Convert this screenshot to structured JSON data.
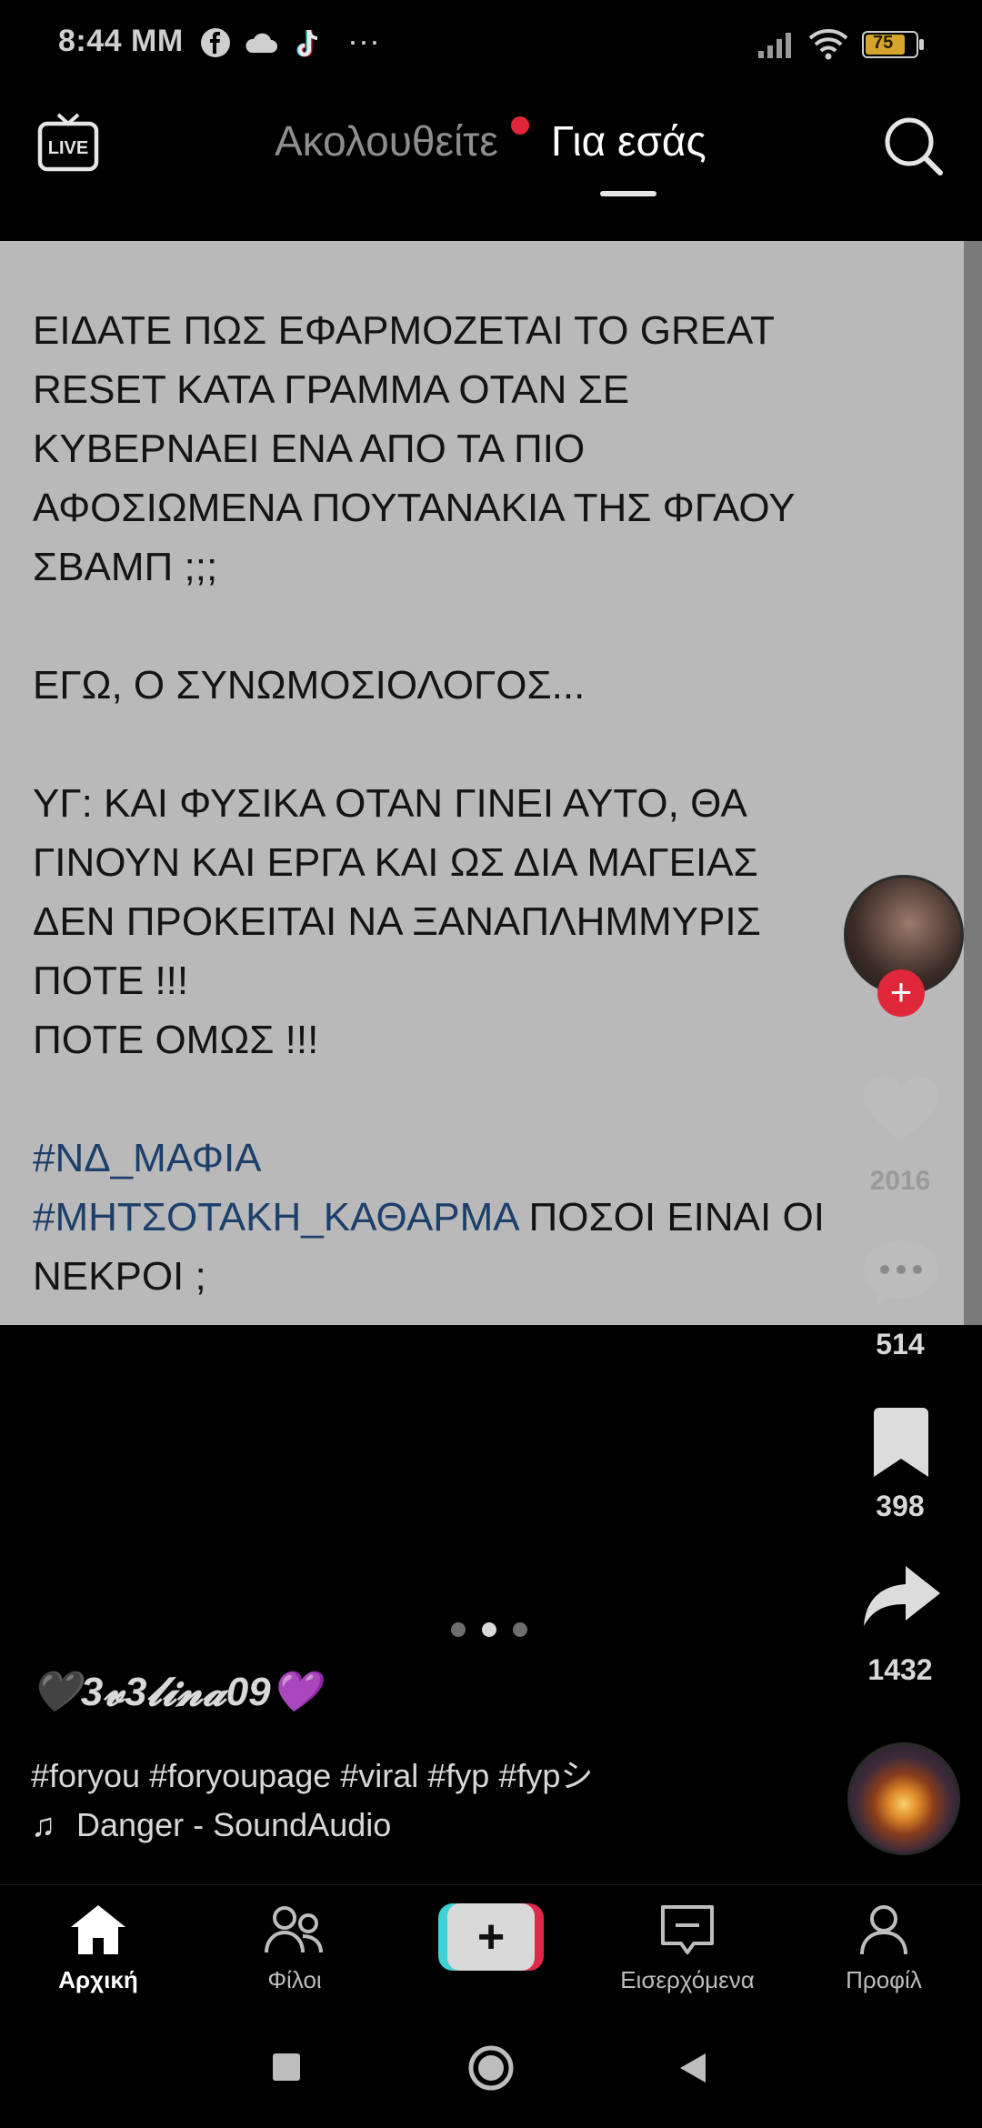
{
  "status_bar": {
    "time": "8:44 MM",
    "battery": "75",
    "icons": [
      "facebook-icon",
      "cloud-icon",
      "tiktok-icon",
      "more-icon",
      "signal-icon",
      "wifi-icon",
      "battery-icon"
    ]
  },
  "top_nav": {
    "live_label": "LIVE",
    "tab_following": "Ακολουθείτε",
    "tab_foryou": "Για εσάς",
    "notification_color": "#e0273a"
  },
  "post": {
    "lines": [
      "ΕΙΔΑΤΕ ΠΩΣ ΕΦΑΡΜΟΖΕΤΑΙ ΤΟ GREAT",
      "RESET ΚΑΤΑ ΓΡΑΜΜΑ ΟΤΑΝ ΣΕ",
      "ΚΥΒΕΡΝΑΕΙ ΕΝΑ ΑΠΟ ΤΑ ΠΙΟ",
      "ΑΦΟΣΙΩΜΕΝΑ ΠΟΥΤΑΝΑΚΙΑ ΤΗΣ ΦΓΑΟΥ",
      "ΣΒΑΜΠ ;;;",
      "ΕΓΩ, Ο ΣΥΝΩΜΟΣΙΟΛΟΓΟΣ...",
      "ΥΓ: ΚΑΙ ΦΥΣΙΚΑ ΟΤΑΝ ΓΙΝΕΙ ΑΥΤΟ, ΘΑ",
      "ΓΙΝΟΥΝ ΚΑΙ ΕΡΓΑ ΚΑΙ ΩΣ ΔΙΑ ΜΑΓΕΙΑΣ",
      "ΔΕΝ ΠΡΟΚΕΙΤΑΙ ΝΑ ΞΑΝΑΠΛΗΜΜΥΡΙΣ",
      "ΠΟΤΕ !!!",
      "ΠΟΤΕ ΟΜΩΣ !!!",
      "#ΝΔ_ΜΑΦΙΑ",
      "#ΜΗΤΣΟΤΑΚΗ_ΚΑΘΑΡΜΑ",
      " ΠΟΣΟΙ ΕΙΝΑΙ ΟΙ",
      "ΝΕΚΡΟΙ ;"
    ],
    "hashtag_color": "#1d3f6b"
  },
  "actions": {
    "likes": "2016",
    "comments": "514",
    "bookmarks": "398",
    "shares": "1432",
    "follow_symbol": "+"
  },
  "info": {
    "username": "🖤3𝓿3𝓵𝓲𝓷𝓪09💜",
    "caption": "#foryou #foryoupage #viral #fyp #fypシ",
    "music_note": "♫",
    "music": "Danger - SoundAudio"
  },
  "bottom_nav": {
    "home": "Αρχική",
    "friends": "Φίλοι",
    "create_symbol": "+",
    "inbox": "Εισερχόμενα",
    "profile": "Προφίλ"
  }
}
